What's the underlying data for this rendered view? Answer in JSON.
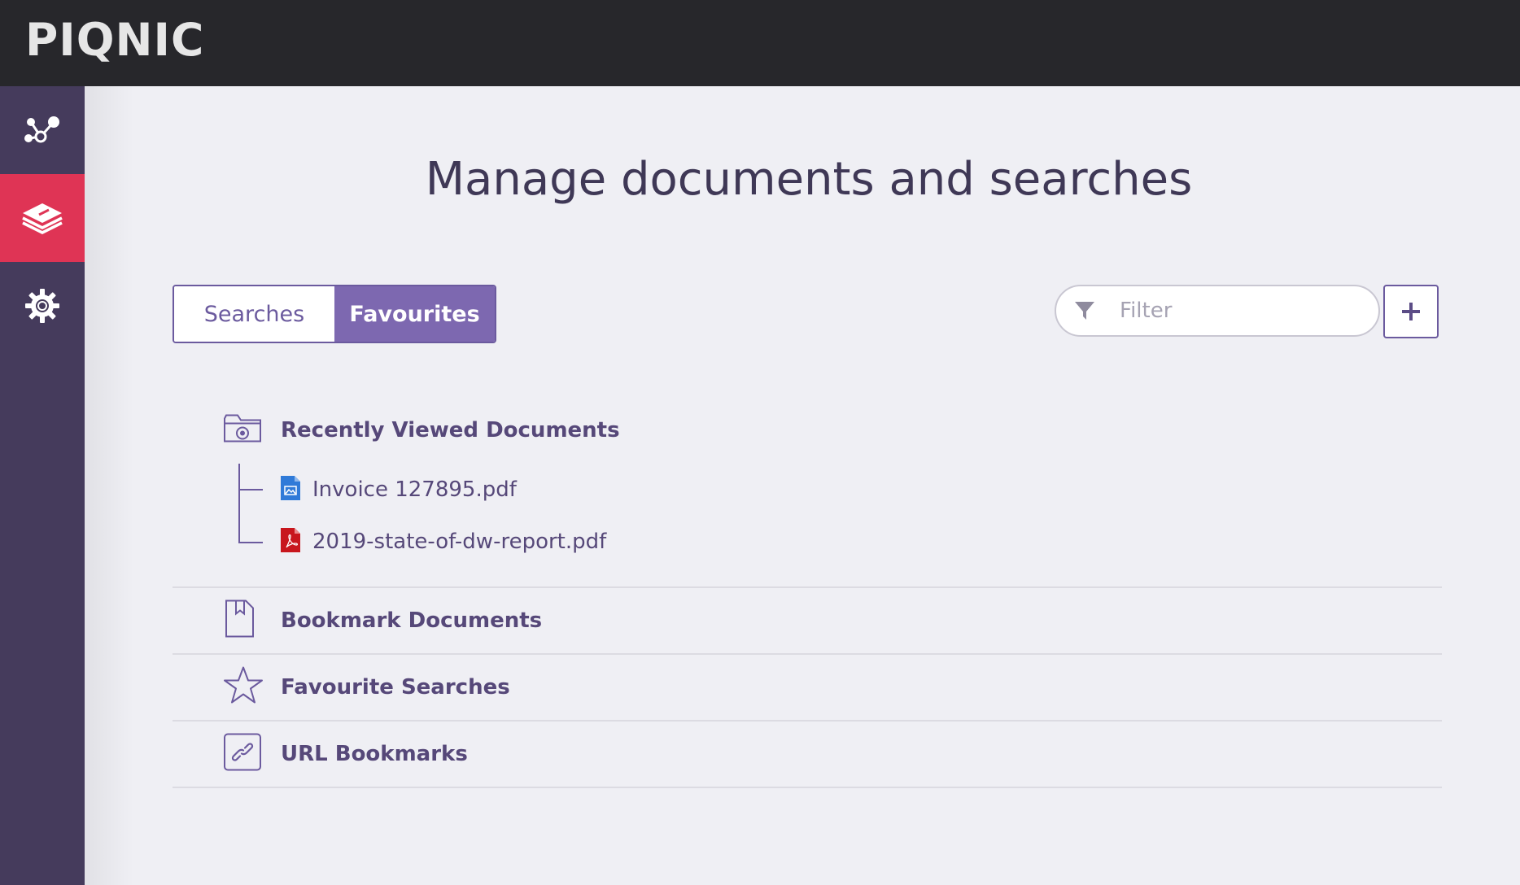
{
  "header": {
    "logo": "PIQNIC"
  },
  "sidebar": {
    "items": [
      {
        "name": "graph",
        "icon": "nodes-icon",
        "active": false
      },
      {
        "name": "documents",
        "icon": "layers-icon",
        "active": true
      },
      {
        "name": "settings",
        "icon": "gear-icon",
        "active": false
      }
    ]
  },
  "main": {
    "title": "Manage documents and searches",
    "tabs": [
      {
        "label": "Searches",
        "active": false
      },
      {
        "label": "Favourites",
        "active": true
      }
    ],
    "filter": {
      "placeholder": "Filter",
      "value": ""
    },
    "sections": [
      {
        "label": "Recently Viewed Documents",
        "icon": "folder-clock-icon",
        "items": [
          {
            "label": "Invoice 127895.pdf",
            "icon": "image-file-icon"
          },
          {
            "label": "2019-state-of-dw-report.pdf",
            "icon": "pdf-file-icon"
          }
        ]
      },
      {
        "label": "Bookmark Documents",
        "icon": "bookmark-document-icon"
      },
      {
        "label": "Favourite Searches",
        "icon": "star-icon"
      },
      {
        "label": "URL Bookmarks",
        "icon": "link-icon"
      }
    ]
  },
  "colors": {
    "topbar": "#27272b",
    "sidebar": "#453b5c",
    "sidebar_active": "#df3455",
    "accent": "#7d68b0",
    "text": "#564879"
  }
}
